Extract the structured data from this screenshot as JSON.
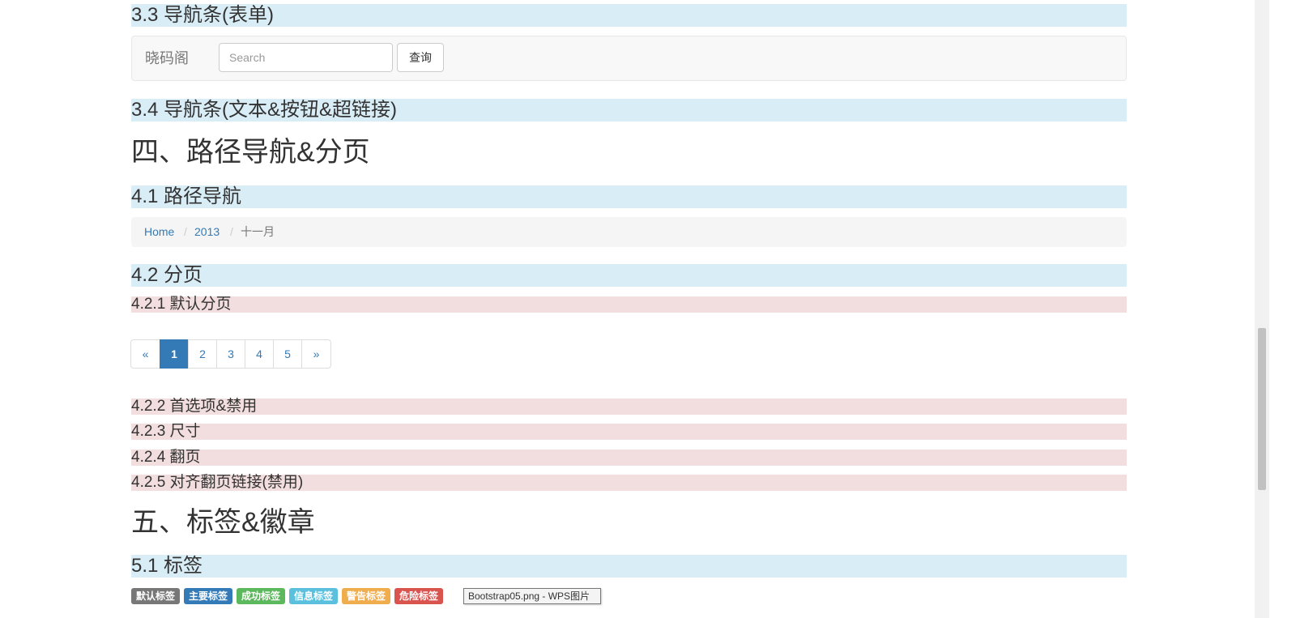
{
  "sections": {
    "s3_3": "3.3 导航条(表单)",
    "s3_4": "3.4 导航条(文本&按钮&超链接)",
    "h4_title": "四、路径导航&分页",
    "s4_1": "4.1 路径导航",
    "s4_2": "4.2 分页",
    "s4_2_1": "4.2.1 默认分页",
    "s4_2_2": "4.2.2 首选项&禁用",
    "s4_2_3": "4.2.3 尺寸",
    "s4_2_4": "4.2.4 翻页",
    "s4_2_5": "4.2.5 对齐翻页链接(禁用)",
    "h5_title": "五、标签&徽章",
    "s5_1": "5.1 标签"
  },
  "navbar": {
    "brand": "晓码阁",
    "search_placeholder": "Search",
    "search_value": "",
    "query_label": "查询"
  },
  "breadcrumb": {
    "items": [
      "Home",
      "2013",
      "十一月"
    ],
    "separator": "/"
  },
  "pagination": {
    "prev": "«",
    "pages": [
      "1",
      "2",
      "3",
      "4",
      "5"
    ],
    "next": "»",
    "active": "1"
  },
  "labels": [
    {
      "text": "默认标签",
      "color": "#777777"
    },
    {
      "text": "主要标签",
      "color": "#337ab7"
    },
    {
      "text": "成功标签",
      "color": "#5cb85c"
    },
    {
      "text": "信息标签",
      "color": "#5bc0de"
    },
    {
      "text": "警告标签",
      "color": "#f0ad4e"
    },
    {
      "text": "危险标签",
      "color": "#d9534f"
    }
  ],
  "tooltip": {
    "text": "Bootstrap05.png - WPS图片"
  },
  "colors": {
    "heading_bg": "#d9edf7",
    "subheading_bg": "#f2dede",
    "link": "#337ab7"
  }
}
